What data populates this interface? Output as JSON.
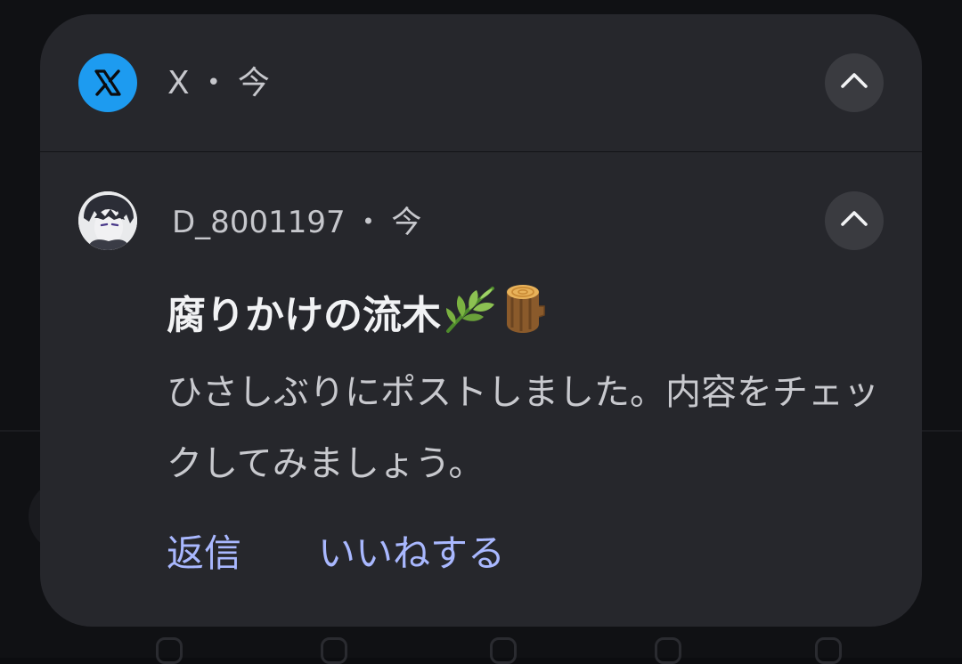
{
  "app_header": {
    "app_name": "X",
    "separator": "•",
    "time": "今",
    "app_icon": "x-logo-icon",
    "collapse_icon": "chevron-up-icon"
  },
  "message": {
    "sender": "D_8001197",
    "separator": "•",
    "time": "今",
    "avatar_icon": "user-avatar",
    "collapse_icon": "chevron-up-icon",
    "title": "腐りかけの流木",
    "title_emoji": [
      "herb-icon",
      "wood-log-icon"
    ],
    "body": "ひさしぶりにポストしました。内容をチェックしてみましょう。"
  },
  "actions": {
    "reply": "返信",
    "like": "いいねする"
  },
  "colors": {
    "card_bg": "#26272c",
    "accent": "#a9b8ff",
    "app_icon_bg": "#1d9bf0"
  }
}
